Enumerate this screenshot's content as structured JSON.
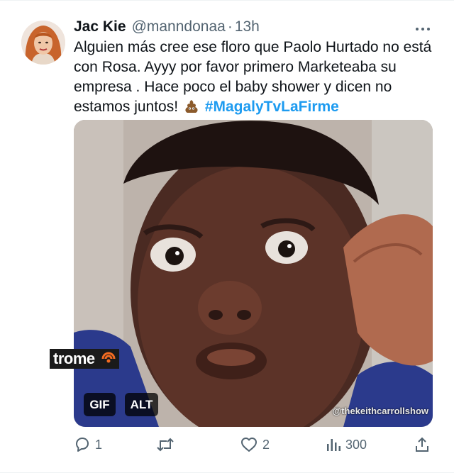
{
  "tweet": {
    "author_name": "Jac Kie",
    "handle": "@manndonaa",
    "separator": "·",
    "time": "13h",
    "text": "Alguien más cree ese floro que Paolo Hurtado no está con Rosa. Ayyy por favor primero Marketeaba su empresa . Hace poco el baby shower y dicen no estamos juntos!",
    "hashtag": "#MagalyTvLaFirme",
    "emoji": "pile-of-poo-emoji"
  },
  "media": {
    "logo_text": "trome",
    "gif_label": "GIF",
    "alt_label": "ALT",
    "watermark": "@thekeithcarrollshow"
  },
  "actions": {
    "reply_count": "1",
    "retweet_count": "",
    "like_count": "2",
    "views_count": "300"
  },
  "colors": {
    "hashtag": "#1d9bf0",
    "secondary_text": "#536471",
    "primary_text": "#0f1419"
  }
}
